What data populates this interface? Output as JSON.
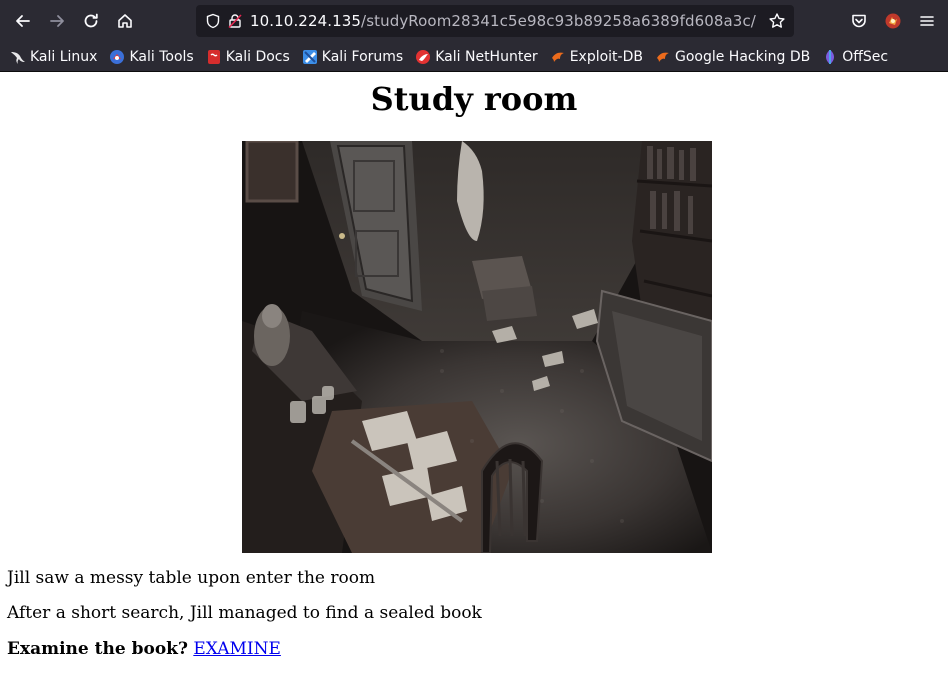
{
  "browser": {
    "url_host": "10.10.224.135",
    "url_path": "/studyRoom28341c5e98c93b89258a6389fd608a3c/",
    "bookmarks": [
      {
        "label": "Kali Linux",
        "icon": "kali-dragon-icon"
      },
      {
        "label": "Kali Tools",
        "icon": "kali-tools-icon"
      },
      {
        "label": "Kali Docs",
        "icon": "kali-docs-icon"
      },
      {
        "label": "Kali Forums",
        "icon": "kali-forums-icon"
      },
      {
        "label": "Kali NetHunter",
        "icon": "nethunter-icon"
      },
      {
        "label": "Exploit-DB",
        "icon": "exploit-db-icon"
      },
      {
        "label": "Google Hacking DB",
        "icon": "ghdb-icon"
      },
      {
        "label": "OffSec",
        "icon": "offsec-icon"
      }
    ]
  },
  "page": {
    "title": "Study room",
    "image_alt": "study room scene",
    "line1": "Jill saw a messy table upon enter the room",
    "line2": "After a short search, Jill managed to find a sealed book",
    "prompt": "Examine the book?",
    "link": "EXAMINE"
  },
  "colors": {
    "chrome_bg": "#2b2a33",
    "urlbar_bg": "#1c1b22",
    "link": "#0000ee"
  }
}
